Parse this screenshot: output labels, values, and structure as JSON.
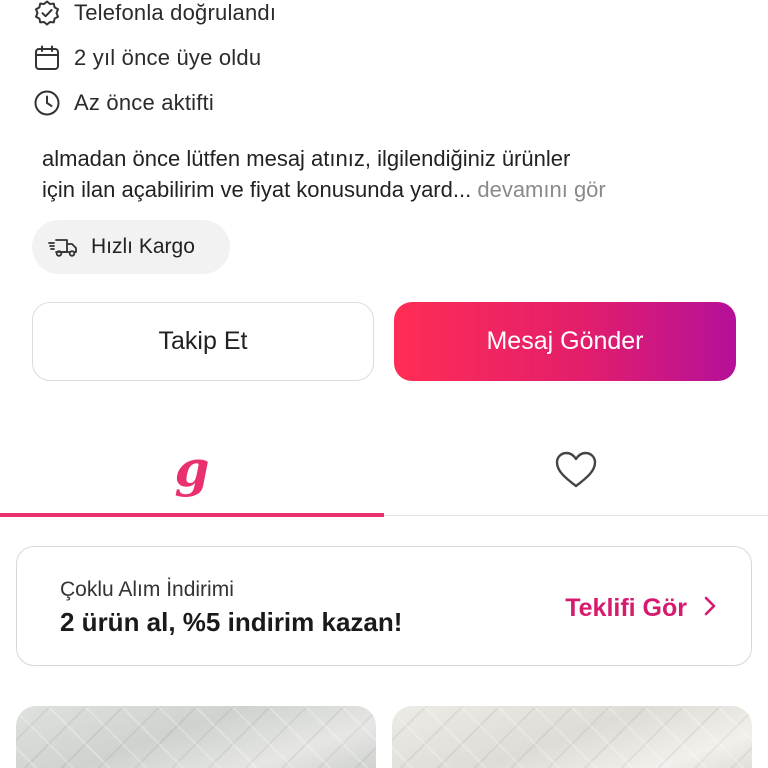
{
  "profile": {
    "verified_label": "Telefonla doğrulandı",
    "member_since_label": "2 yıl önce üye oldu",
    "activity_label": "Az önce aktifti",
    "bio_line1": "almadan önce lütfen mesaj atınız, ilgilendiğiniz ürünler",
    "bio_line2": "için ilan açabilirim ve fiyat konusunda yard...",
    "bio_more": "devamını gör",
    "shipping_chip": "Hızlı Kargo"
  },
  "actions": {
    "follow_label": "Takip Et",
    "message_label": "Mesaj Gönder"
  },
  "tabs": {
    "products_logo": "g",
    "active_tab": "products"
  },
  "offer": {
    "subtitle": "Çoklu Alım İndirimi",
    "title": "2 ürün al, %5 indirim kazan!",
    "cta": "Teklifi Gör"
  },
  "colors": {
    "accent": "#e8316d",
    "gradient_start": "#ff2d55",
    "gradient_end": "#b5109a",
    "cta_text": "#d61a6e"
  },
  "icons": {
    "verified": "badge-check-icon",
    "member_since": "calendar-icon",
    "activity": "clock-icon",
    "shipping": "fast-truck-icon",
    "favorites_tab": "heart-icon",
    "offer_cta": "chevron-right-icon"
  }
}
